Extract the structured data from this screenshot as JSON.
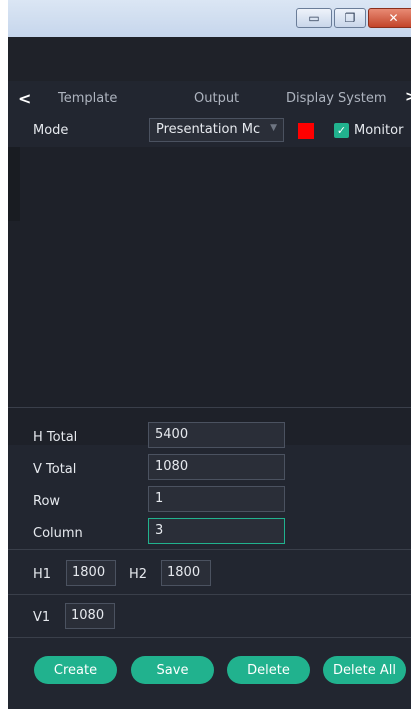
{
  "window": {
    "minimize_glyph": "▭",
    "maximize_glyph": "❐",
    "close_glyph": "✕"
  },
  "tabs": {
    "left_arrow": "<",
    "right_arrow": ">",
    "items": [
      {
        "label": "Template"
      },
      {
        "label": "Output"
      },
      {
        "label": "Display System"
      }
    ]
  },
  "mode": {
    "label": "Mode",
    "selected": "Presentation Mc",
    "color": "#ff0000",
    "monitor_checked": true,
    "monitor_label": "Monitor"
  },
  "fields": {
    "h_total": {
      "label": "H Total",
      "value": "5400"
    },
    "v_total": {
      "label": "V Total",
      "value": "1080"
    },
    "row": {
      "label": "Row",
      "value": "1"
    },
    "column": {
      "label": "Column",
      "value": "3"
    }
  },
  "sizes": {
    "h1": {
      "label": "H1",
      "value": "1800"
    },
    "h2": {
      "label": "H2",
      "value": "1800"
    },
    "v1": {
      "label": "V1",
      "value": "1080"
    }
  },
  "actions": {
    "create": "Create",
    "save": "Save",
    "delete": "Delete",
    "delete_all": "Delete All"
  },
  "colors": {
    "accent": "#21b28e",
    "background": "#222630"
  }
}
